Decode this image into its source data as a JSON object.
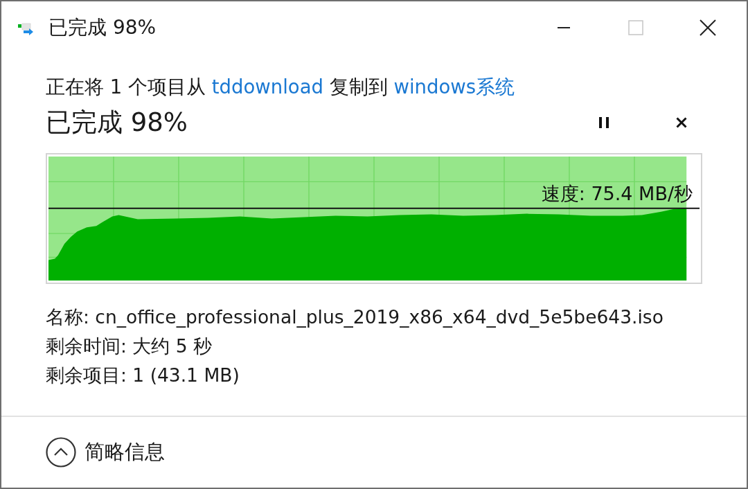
{
  "window": {
    "title": "已完成 98%",
    "controls": [
      {
        "kind": "minimize",
        "disabled": false
      },
      {
        "kind": "maximize",
        "disabled": true
      },
      {
        "kind": "close",
        "disabled": false
      }
    ]
  },
  "copy_description": [
    {
      "kind": "text",
      "text": "正在将 1 个项目从 "
    },
    {
      "kind": "link",
      "text": "tddownload"
    },
    {
      "kind": "text",
      "text": " 复制到 "
    },
    {
      "kind": "link",
      "text": "windows系统"
    }
  ],
  "status": "已完成 98%",
  "progress": {
    "level": 0.98,
    "speed": "速度: 75.4 MB/秒"
  },
  "details": [
    "名称: cn_office_professional_plus_2019_x86_x64_dvd_5e5be643.iso",
    "剩余时间: 大约 5 秒",
    "剩余项目: 1 (43.1 MB)"
  ],
  "footer": {
    "toggle": {
      "label": "简略信息",
      "expanded": true
    }
  }
}
